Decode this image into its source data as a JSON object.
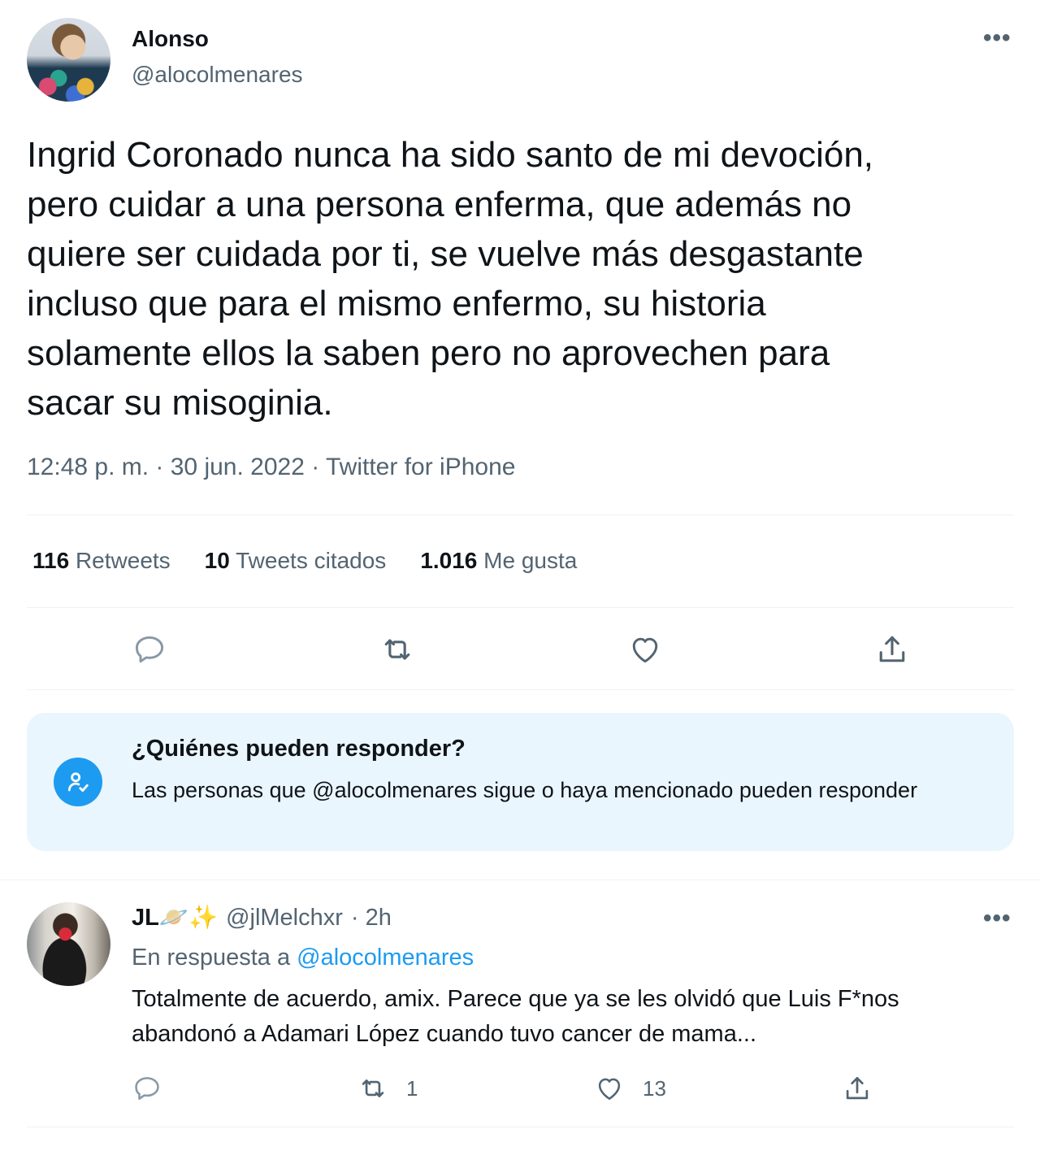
{
  "tweet": {
    "author_name": "Alonso",
    "author_handle": "@alocolmenares",
    "more_icon": "more-horizontal-icon",
    "text": "Ingrid Coronado nunca  ha sido santo de mi devoción,\npero cuidar a una persona enferma, que además no\nquiere ser cuidada por ti, se vuelve más desgastante\nincluso  que para el mismo enfermo, su historia\nsolamente ellos la saben pero no aprovechen para\nsacar su misoginia.",
    "meta": "12:48 p. m. · 30 jun. 2022 · Twitter for iPhone",
    "stats": [
      {
        "count": "116",
        "label": "Retweets"
      },
      {
        "count": "10",
        "label": "Tweets citados"
      },
      {
        "count": "1.016",
        "label": "Me gusta"
      }
    ],
    "actions": [
      "reply-icon",
      "retweet-icon",
      "like-icon",
      "share-icon"
    ]
  },
  "reply_notice": {
    "icon": "mention-user-icon",
    "title": "¿Quiénes pueden responder?",
    "body": "Las personas que @alocolmenares sigue o haya mencionado pueden responder"
  },
  "reply": {
    "author_name": "JL🪐✨",
    "author_handle": "@jlMelchxr",
    "time": "· 2h",
    "in_reply_prefix": "En respuesta a",
    "in_reply_handle": "@alocolmenares",
    "text": "Totalmente de acuerdo, amix. Parece que ya se les olvidó que Luis F*nos abandonó a Adamari López cuando tuvo cancer de mama...",
    "retweets": "1",
    "likes": "13"
  },
  "colors": {
    "accent": "#1d9bf0",
    "secondary_text": "#536471",
    "notice_bg": "#eaf6fd",
    "divider": "#eff3f4"
  }
}
